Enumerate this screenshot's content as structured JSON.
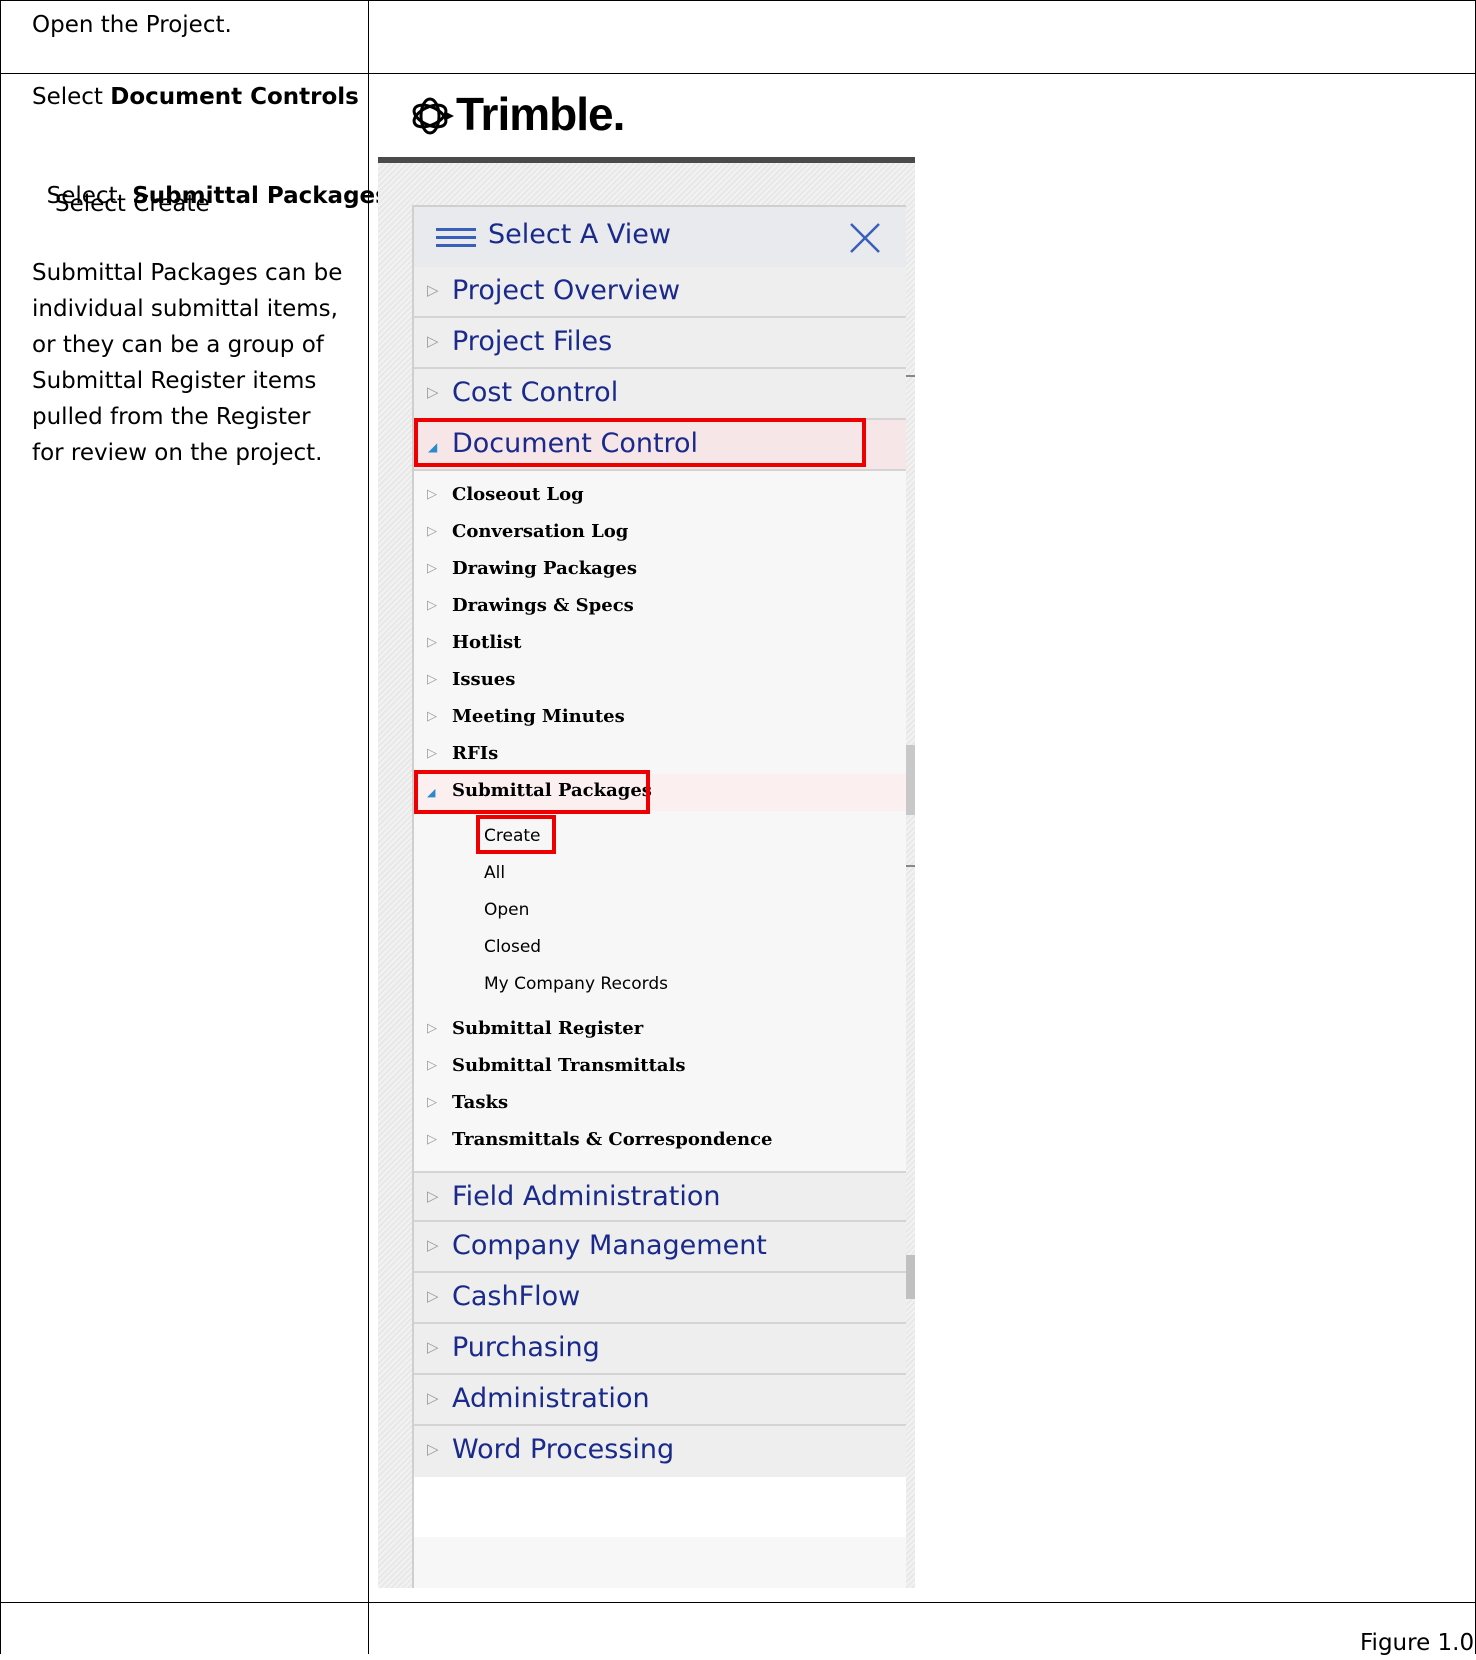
{
  "doc": {
    "step1": "Open the Project.",
    "step2_prefix": "Select ",
    "step2_bold": "Document Controls",
    "step3_prefix": "Select  ",
    "step3_bold": "Submittal Packages",
    "step4": "Select Create",
    "description_lines": [
      "Submittal Packages can be",
      "individual submittal items,",
      "or they can be a group of",
      "Submittal Register items",
      "pulled from the Register",
      "for review on the project."
    ],
    "caption": "Figure 1.0"
  },
  "app": {
    "logo_text": "Trimble.",
    "menu_title": "Select A View",
    "sections_top": [
      "Project Overview",
      "Project Files",
      "Cost Control"
    ],
    "open_section": "Document Control",
    "document_control_items": [
      "Closeout Log",
      "Conversation Log",
      "Drawing Packages",
      "Drawings & Specs",
      "Hotlist",
      "Issues",
      "Meeting Minutes",
      "RFIs"
    ],
    "open_item": "Submittal Packages",
    "submittal_packages_children": [
      "Create",
      "All",
      "Open",
      "Closed",
      "My Company Records"
    ],
    "document_control_items_after": [
      "Submittal Register",
      "Submittal Transmittals",
      "Tasks",
      "Transmittals & Correspondence"
    ],
    "sections_bottom": [
      "Field Administration",
      "Company Management",
      "CashFlow",
      "Purchasing",
      "Administration",
      "Word Processing"
    ],
    "highlight_color": "#ee0000",
    "menu_text_color": "#1a2a8a"
  }
}
